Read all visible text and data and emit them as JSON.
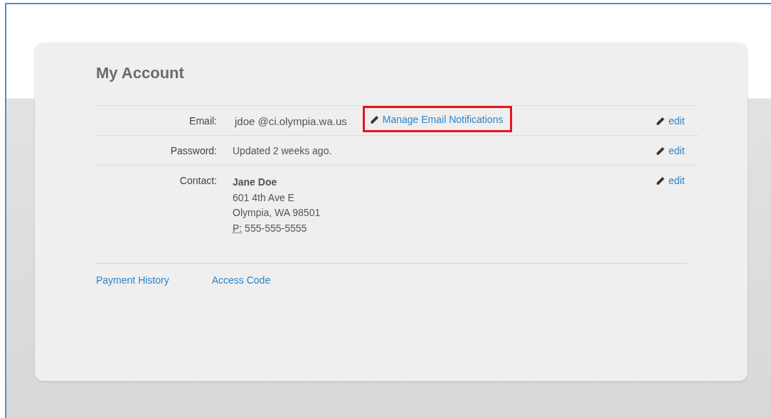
{
  "title": "My Account",
  "rows": [
    {
      "kind": "email",
      "label": "Email:",
      "value": "jdoe @ci.olympia.wa.us",
      "link": {
        "label": "Manage Email Notifications",
        "highlighted": true
      },
      "action": "edit"
    },
    {
      "kind": "text",
      "label": "Password:",
      "value": "Updated 2 weeks ago.",
      "action": "edit"
    },
    {
      "kind": "contact",
      "label": "Contact:",
      "name": "Jane Doe",
      "address_lines": [
        "601 4th Ave E",
        "Olympia, WA 98501"
      ],
      "phone_label": "P:",
      "phone": "555-555-5555",
      "action": "edit"
    }
  ],
  "footer_links": [
    "Payment History",
    "Access Code"
  ]
}
